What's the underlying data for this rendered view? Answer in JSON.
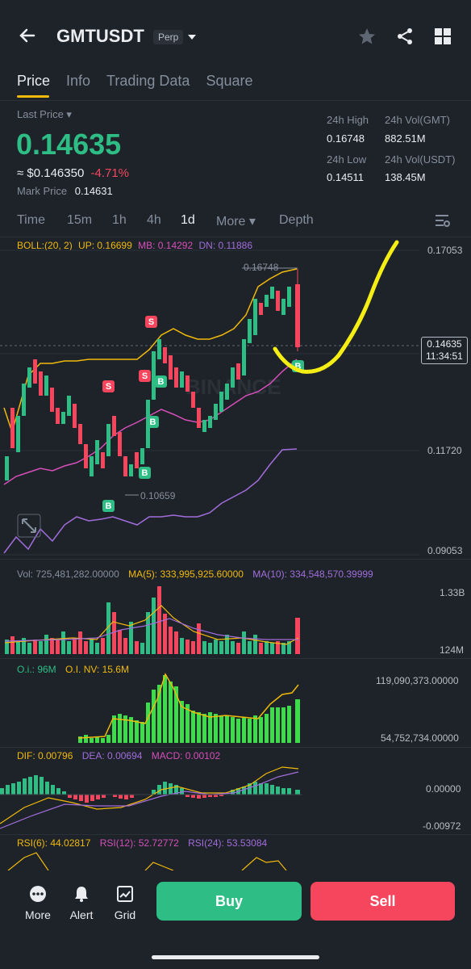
{
  "header": {
    "symbol": "GMTUSDT",
    "tag": "Perp"
  },
  "tabs": [
    "Price",
    "Info",
    "Trading Data",
    "Square"
  ],
  "price": {
    "last_label": "Last Price",
    "last": "0.14635",
    "usd": "≈ $0.146350",
    "change": "-4.71%",
    "mark_label": "Mark Price",
    "mark": "0.14631"
  },
  "stats": {
    "high_label": "24h High",
    "high": "0.16748",
    "low_label": "24h Low",
    "low": "0.14511",
    "volgmt_label": "24h Vol(GMT)",
    "volgmt": "882.51M",
    "volusdt_label": "24h Vol(USDT)",
    "volusdt": "138.45M"
  },
  "intervals": [
    "Time",
    "15m",
    "1h",
    "4h",
    "1d",
    "More",
    "Depth"
  ],
  "boll": {
    "label": "BOLL:(20, 2)",
    "up": "UP: 0.16699",
    "mb": "MB: 0.14292",
    "dn": "DN: 0.11886"
  },
  "axis": {
    "top": "0.17053",
    "mid": "0.11720",
    "bottom": "0.09053",
    "cur_price": "0.14635",
    "cur_time": "11:34:51",
    "hi_mark": "0.16748",
    "lo_mark": "0.10659"
  },
  "watermark": "BINANCE",
  "volume": {
    "vol": "Vol: 725,481,282.00000",
    "ma5": "MA(5): 333,995,925.60000",
    "ma10": "MA(10): 334,548,570.39999",
    "top": "1.33B",
    "bottom": "124M"
  },
  "oi": {
    "oi": "O.i.: 96M",
    "nv": "O.I. NV: 15.6M",
    "top": "119,090,373.00000",
    "bottom": "54,752,734.00000"
  },
  "macd": {
    "dif": "DIF: 0.00796",
    "dea": "DEA: 0.00694",
    "macd": "MACD: 0.00102",
    "top": "0.00000",
    "bottom": "-0.00972"
  },
  "rsi": {
    "r6": "RSI(6): 44.02817",
    "r12": "RSI(12): 52.72772",
    "r24": "RSI(24): 53.53084"
  },
  "bottom": {
    "more": "More",
    "alert": "Alert",
    "grid": "Grid",
    "buy": "Buy",
    "sell": "Sell"
  },
  "colors": {
    "green": "#2ebd85",
    "red": "#f6465d",
    "yellow": "#f0b90b",
    "purple": "#a16ddb",
    "pink": "#d64fb9"
  }
}
